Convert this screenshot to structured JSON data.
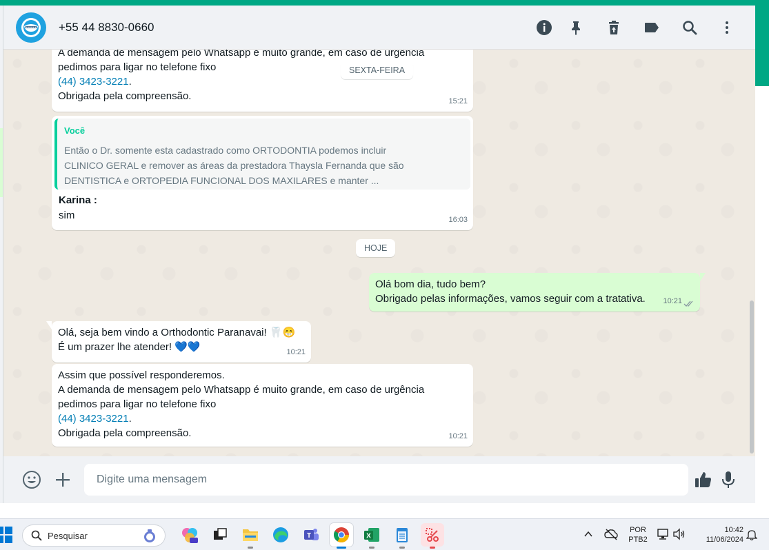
{
  "header": {
    "contact_name": "+55 44 8830-0660",
    "icons": [
      "info-icon",
      "pin-icon",
      "delete-icon",
      "label-icon",
      "search-icon",
      "more-options-icon"
    ]
  },
  "chat": {
    "date_friday": "SEXTA-FEIRA",
    "date_today": "HOJE",
    "messages": [
      {
        "direction": "in",
        "lines": [
          "A demanda de mensagem pelo Whatsapp é muito grande, em caso de urgência",
          "pedimos para ligar no telefone fixo"
        ],
        "phone": "(44) 3423-3221",
        "phone_suffix": ".",
        "closing": "Obrigada pela compreensão.",
        "time": "15:21"
      },
      {
        "direction": "in",
        "quote_author": "Você",
        "quote_lines": [
          "Então o Dr. somente esta cadastrado como ORTODONTIA podemos incluir",
          "CLINICO GERAL e remover as áreas da prestadora Thaysla Fernanda que são",
          "DENTISTICA e ORTOPEDIA FUNCIONAL DOS MAXILARES e manter ..."
        ],
        "sender": "Karina :",
        "text": "sim",
        "time": "16:03"
      },
      {
        "direction": "out",
        "lines": [
          "Olá bom dia, tudo bem?",
          "Obrigado pelas informações, vamos seguir com a tratativa."
        ],
        "time": "10:21",
        "status": "read"
      },
      {
        "direction": "in",
        "lines": [
          "Olá, seja bem vindo a Orthodontic Paranavai! 🦷😁",
          "É um prazer lhe atender! 💙💙"
        ],
        "time": "10:21"
      },
      {
        "direction": "in",
        "lines": [
          "Assim que possível responderemos.",
          "A demanda de mensagem pelo Whatsapp é muito grande, em caso de urgência",
          "pedimos para ligar no telefone fixo"
        ],
        "phone": "(44) 3423-3221",
        "phone_suffix": ".",
        "closing": "Obrigada pela compreensão.",
        "time": "10:21"
      }
    ]
  },
  "composer": {
    "placeholder": "Digite uma mensagem"
  },
  "taskbar": {
    "search_label": "Pesquisar",
    "lang_top": "POR",
    "lang_bottom": "PTB2",
    "clock_time": "10:42",
    "clock_date": "11/06/2024"
  },
  "colors": {
    "accent": "#00a884",
    "outgoing_bubble": "#d9fdd3",
    "incoming_bubble": "#ffffff",
    "chat_bg": "#efeae2",
    "link": "#027eb5",
    "quote_bar": "#06cf9c"
  }
}
